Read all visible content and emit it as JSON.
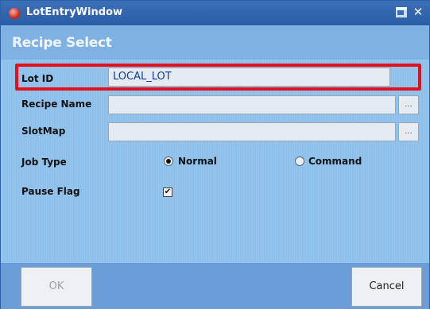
{
  "window": {
    "title": "LotEntryWindow",
    "close_glyph": "✕",
    "icons": {
      "app": "app-icon",
      "maximize": "maximize-icon",
      "close": "close-icon"
    }
  },
  "header": {
    "title": "Recipe Select"
  },
  "form": {
    "lot_id": {
      "label": "Lot ID",
      "value": "LOCAL_LOT"
    },
    "recipe_name": {
      "label": "Recipe Name",
      "value": "",
      "browse_label": "..."
    },
    "slot_map": {
      "label": "SlotMap",
      "value": "",
      "browse_label": "..."
    },
    "job_type": {
      "label": "Job Type",
      "options": [
        "Normal",
        "Command"
      ],
      "selected": "Normal"
    },
    "pause_flag": {
      "label": "Pause Flag",
      "checked": true,
      "check_glyph": "✔"
    }
  },
  "buttons": {
    "ok": "OK",
    "cancel": "Cancel"
  },
  "colors": {
    "highlight": "#e4101a",
    "title_bar": "#2a5ba6",
    "panel": "#8ec0ec"
  }
}
